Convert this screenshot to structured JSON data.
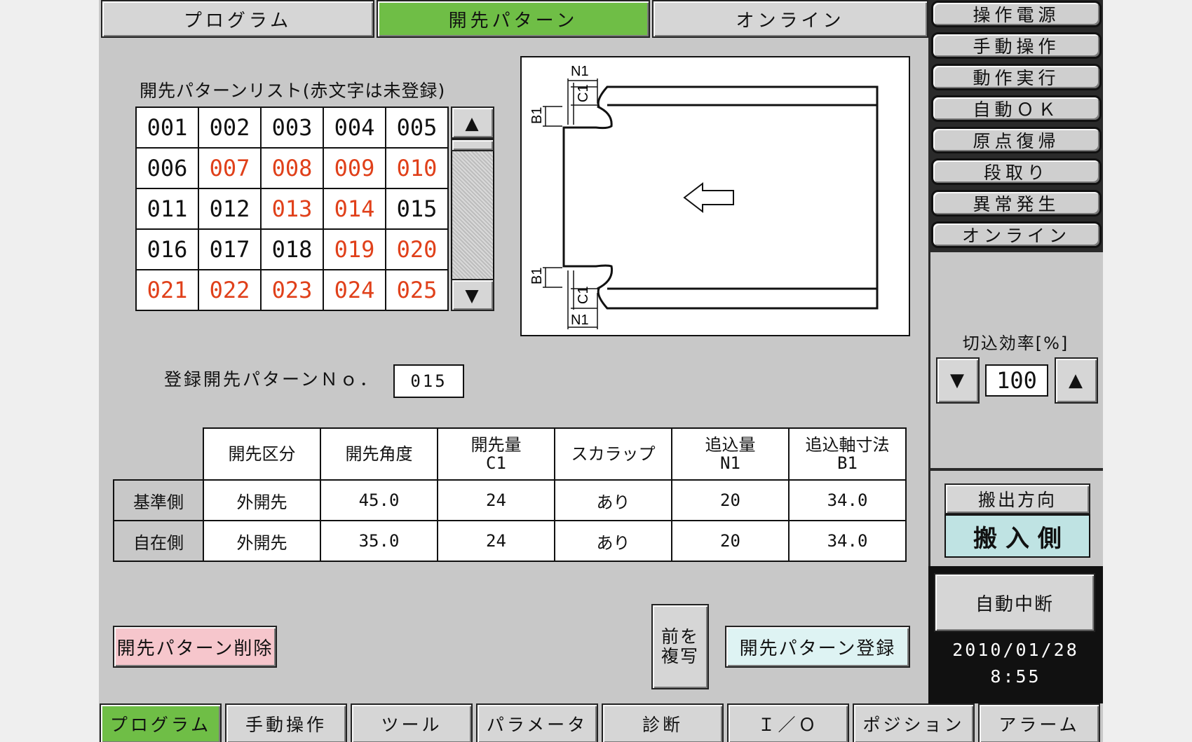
{
  "top_tabs": [
    "プログラム",
    "開先パターン",
    "オンライン"
  ],
  "status_panel": [
    "操作電源",
    "手動操作",
    "動作実行",
    "自動ＯＫ",
    "原点復帰",
    "段取り",
    "異常発生",
    "オンライン"
  ],
  "pattern_list": {
    "title": "開先パターンリスト(赤文字は未登録)",
    "rows": [
      [
        {
          "no": "001",
          "unregistered": false
        },
        {
          "no": "002",
          "unregistered": false
        },
        {
          "no": "003",
          "unregistered": false
        },
        {
          "no": "004",
          "unregistered": false
        },
        {
          "no": "005",
          "unregistered": false
        }
      ],
      [
        {
          "no": "006",
          "unregistered": false
        },
        {
          "no": "007",
          "unregistered": true
        },
        {
          "no": "008",
          "unregistered": true
        },
        {
          "no": "009",
          "unregistered": true
        },
        {
          "no": "010",
          "unregistered": true
        }
      ],
      [
        {
          "no": "011",
          "unregistered": false
        },
        {
          "no": "012",
          "unregistered": false
        },
        {
          "no": "013",
          "unregistered": true
        },
        {
          "no": "014",
          "unregistered": true
        },
        {
          "no": "015",
          "unregistered": true
        }
      ],
      [
        {
          "no": "016",
          "unregistered": false
        },
        {
          "no": "017",
          "unregistered": false
        },
        {
          "no": "018",
          "unregistered": false
        },
        {
          "no": "019",
          "unregistered": true
        },
        {
          "no": "020",
          "unregistered": true
        }
      ],
      [
        {
          "no": "021",
          "unregistered": true
        },
        {
          "no": "022",
          "unregistered": true
        },
        {
          "no": "023",
          "unregistered": true
        },
        {
          "no": "024",
          "unregistered": true
        },
        {
          "no": "025",
          "unregistered": true
        }
      ]
    ],
    "selected": "015"
  },
  "diagram": {
    "label_n1": "N1",
    "label_c1": "C1",
    "label_b1": "B1"
  },
  "registered_no": {
    "label": "登録開先パターンＮｏ．",
    "value": "015"
  },
  "params": {
    "headers": [
      {
        "line1": "開先区分",
        "line2": ""
      },
      {
        "line1": "開先角度",
        "line2": ""
      },
      {
        "line1": "開先量",
        "line2": "C1"
      },
      {
        "line1": "スカラップ",
        "line2": ""
      },
      {
        "line1": "追込量",
        "line2": "N1"
      },
      {
        "line1": "追込軸寸法",
        "line2": "B1"
      }
    ],
    "rows": [
      {
        "label": "基準側",
        "values": [
          "外開先",
          "45.0",
          "24",
          "あり",
          "20",
          "34.0"
        ]
      },
      {
        "label": "自在側",
        "values": [
          "外開先",
          "35.0",
          "24",
          "あり",
          "20",
          "34.0"
        ]
      }
    ]
  },
  "cut_efficiency": {
    "label": "切込効率[%]",
    "value": "100"
  },
  "delete_button": "開先パターン削除",
  "copy_button": [
    "前を",
    "複写"
  ],
  "register_button": "開先パターン登録",
  "direction": {
    "label": "搬出方向",
    "value": "搬 入 側"
  },
  "auto_stop": "自動中断",
  "date": "2010/01/28",
  "time": "8:55",
  "bottom_tabs": [
    "プログラム",
    "手動操作",
    "ツール",
    "パラメータ",
    "診断",
    "Ｉ／Ｏ",
    "ポジション",
    "アラーム"
  ],
  "colors": {
    "active_tab": "#6fbe46",
    "unregistered_text": "#e0401a",
    "selected_cell": "#9ed4d4",
    "delete_button": "#f6c6cc",
    "register_button": "#def3f3"
  }
}
